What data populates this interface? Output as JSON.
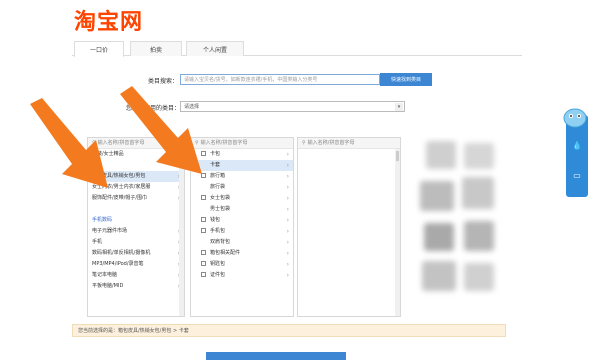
{
  "header": {
    "logo_text": "淘宝网"
  },
  "tabs": [
    {
      "label": "一口价"
    },
    {
      "label": "拍卖"
    },
    {
      "label": "个人闲置"
    }
  ],
  "category_search": {
    "label": "类目搜索：",
    "placeholder": "请输入宝贝名/货号，如新款连衣裙/手机，中国类输入分类号",
    "button_label": "快速找到类目"
  },
  "recent": {
    "label": "您最近使用的类目：",
    "value": "请选择"
  },
  "panels": {
    "panel1": {
      "search_placeholder": "输入名称/拼音首字母",
      "items": [
        {
          "label": "女装/女士精品",
          "chevron": false,
          "selected": false,
          "group": false
        },
        {
          "label": "女鞋",
          "chevron": false,
          "selected": false,
          "group": false
        },
        {
          "label": "箱包皮具/热销女包/男包",
          "chevron": true,
          "selected": true,
          "group": false
        },
        {
          "label": "女士内衣/男士内衣/家居服",
          "chevron": true,
          "selected": false,
          "group": false
        },
        {
          "label": "服饰配件/皮带/帽子/围巾",
          "chevron": true,
          "selected": false,
          "group": false
        },
        {
          "label": "",
          "chevron": false,
          "selected": false,
          "group": false
        },
        {
          "label": "手机数码",
          "chevron": false,
          "selected": false,
          "group": true
        },
        {
          "label": "电子元器件市场",
          "chevron": true,
          "selected": false,
          "group": false
        },
        {
          "label": "手机",
          "chevron": true,
          "selected": false,
          "group": false
        },
        {
          "label": "数码相机/单反相机/摄像机",
          "chevron": true,
          "selected": false,
          "group": false
        },
        {
          "label": "MP3/MP4/iPod/录音笔",
          "chevron": true,
          "selected": false,
          "group": false
        },
        {
          "label": "笔记本电脑",
          "chevron": true,
          "selected": false,
          "group": false
        },
        {
          "label": "平板电脑/MID",
          "chevron": true,
          "selected": false,
          "group": false
        }
      ]
    },
    "panel2": {
      "search_placeholder": "输入名称/拼音首字母",
      "items": [
        {
          "label": "卡包",
          "checkbox": true,
          "chevron": true,
          "selected": false
        },
        {
          "label": "卡套",
          "checkbox": false,
          "chevron": true,
          "selected": true
        },
        {
          "label": "旅行箱",
          "checkbox": true,
          "chevron": true,
          "selected": false
        },
        {
          "label": "旅行袋",
          "checkbox": false,
          "chevron": true,
          "selected": false
        },
        {
          "label": "女士包袋",
          "checkbox": true,
          "chevron": true,
          "selected": false
        },
        {
          "label": "男士包袋",
          "checkbox": false,
          "chevron": true,
          "selected": false
        },
        {
          "label": "钱包",
          "checkbox": true,
          "chevron": true,
          "selected": false
        },
        {
          "label": "手机包",
          "checkbox": true,
          "chevron": true,
          "selected": false
        },
        {
          "label": "双肩背包",
          "checkbox": false,
          "chevron": true,
          "selected": false
        },
        {
          "label": "箱包相关配件",
          "checkbox": true,
          "chevron": true,
          "selected": false
        },
        {
          "label": "钥匙包",
          "checkbox": true,
          "chevron": true,
          "selected": false
        },
        {
          "label": "证件包",
          "checkbox": true,
          "chevron": true,
          "selected": false
        }
      ]
    },
    "panel3": {
      "search_placeholder": "输入名称/拼音首字母"
    }
  },
  "selection_path": {
    "text": "您当前选择的是：箱包皮具/热销女包/男包 > 卡套"
  },
  "side_widget": {
    "icons": [
      "mascot-icon",
      "water-drop-icon",
      "bookmark-icon"
    ]
  },
  "colors": {
    "brand": "#ff4400",
    "accent_blue": "#3c86d4",
    "arrow_orange": "#f47a1f",
    "selected_row": "#dbe8f7"
  }
}
